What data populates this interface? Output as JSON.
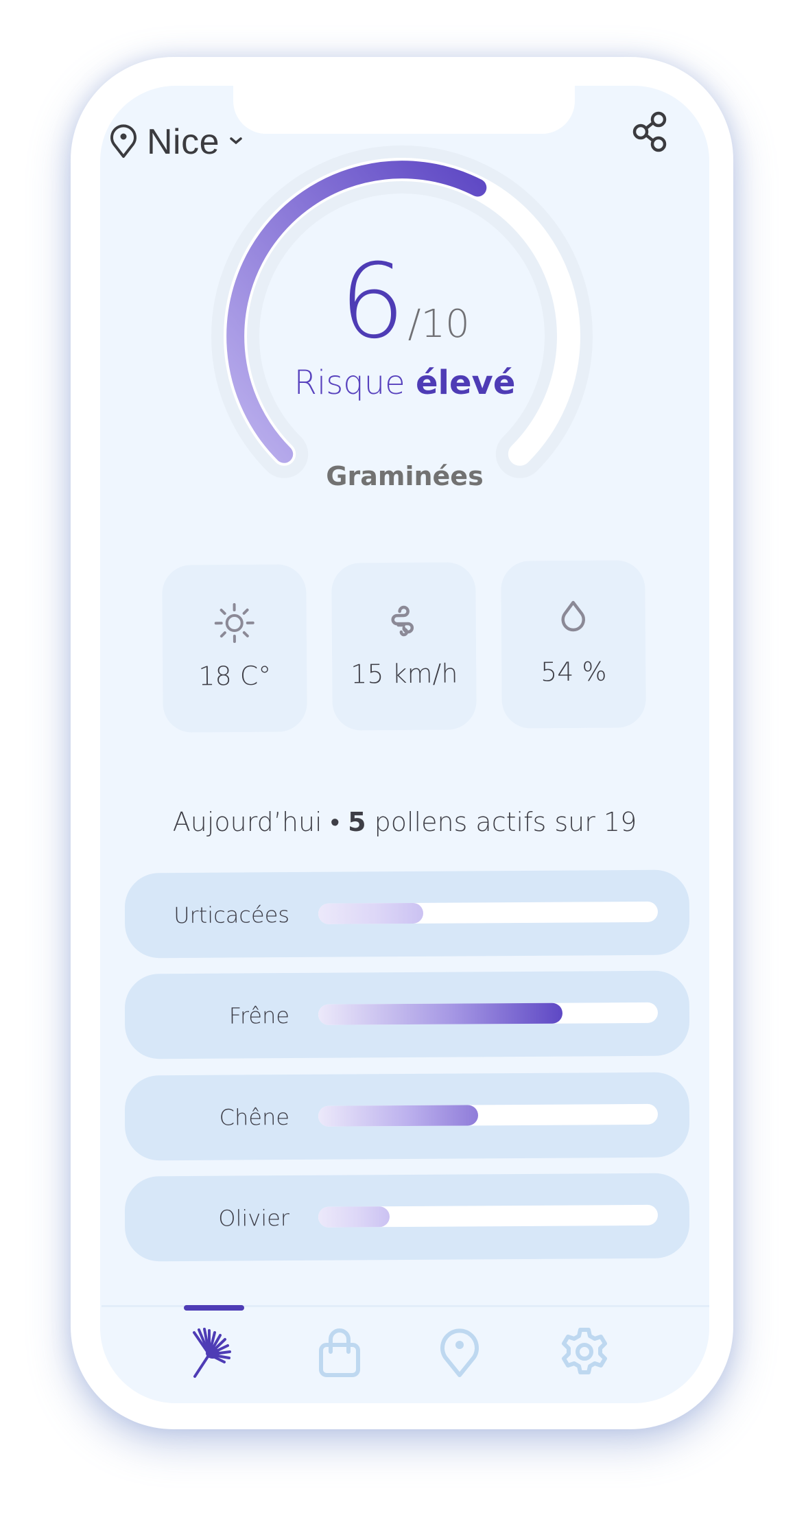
{
  "header": {
    "location_icon": "map-pin-icon",
    "city": "Nice",
    "city_dropdown_icon": "chevron-down-icon",
    "share_icon": "share-icon"
  },
  "gauge": {
    "score": "6",
    "max": "/10",
    "score_value": 6,
    "score_max": 10,
    "risk_prefix": "Risque",
    "risk_level": "élevé",
    "pollen_name": "Graminées"
  },
  "weather": [
    {
      "icon": "sun-icon",
      "value": "18 C°"
    },
    {
      "icon": "wind-icon",
      "value": "15 km/h"
    },
    {
      "icon": "droplet-icon",
      "value": "54 %"
    }
  ],
  "summary": {
    "prefix": "Aujourd’hui •",
    "count": "5",
    "suffix": "pollens actifs sur 19"
  },
  "pollens": [
    {
      "name": "Urticacées",
      "level": 0.31
    },
    {
      "name": "Frêne",
      "level": 0.72
    },
    {
      "name": "Chêne",
      "level": 0.47
    },
    {
      "name": "Olivier",
      "level": 0.21
    }
  ],
  "nav": [
    {
      "icon": "dandelion-icon",
      "active": true
    },
    {
      "icon": "shopping-bag-icon",
      "active": false
    },
    {
      "icon": "map-pin-icon",
      "active": false
    },
    {
      "icon": "gear-icon",
      "active": false
    }
  ],
  "colors": {
    "accent": "#4e3cb5",
    "accent_light": "#b9aeec",
    "screen_bg": "#eff6fe",
    "card_bg": "#e6f0fb",
    "row_bg": "#d7e7f8",
    "icon_grey": "#8b8996",
    "nav_inactive": "#bed8f0"
  }
}
